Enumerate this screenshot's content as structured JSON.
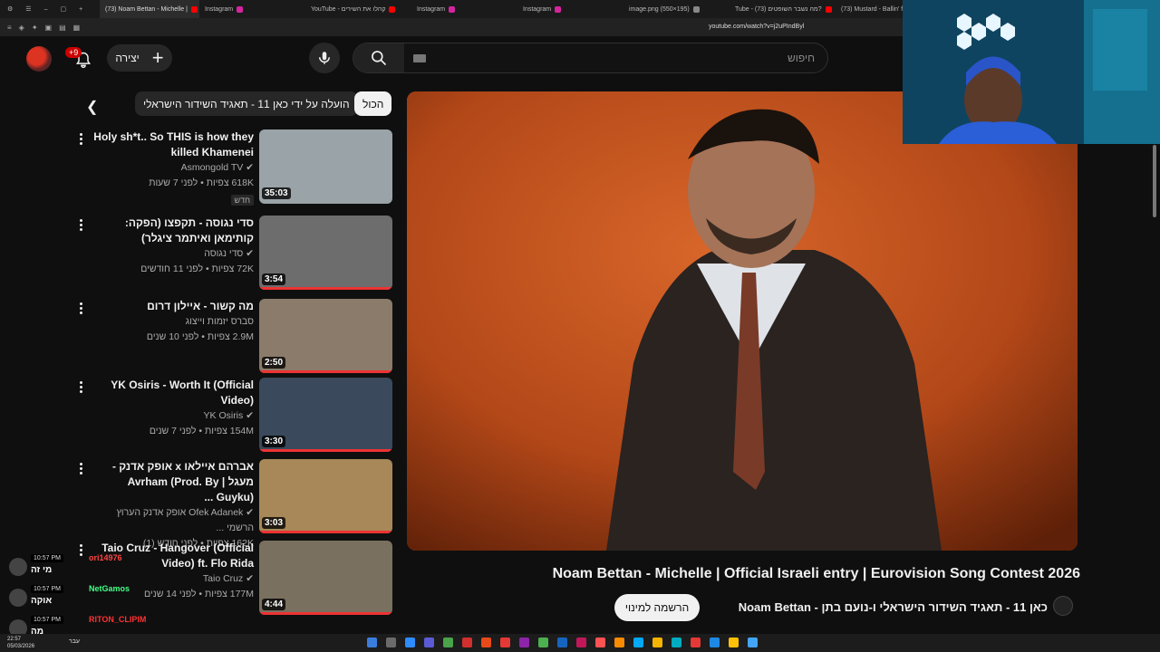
{
  "browser": {
    "tabs": [
      {
        "label": "(73) Noam Bettan - Michelle |",
        "color": "#ff0000",
        "active": true
      },
      {
        "label": "Instagram",
        "color": "#d6249f"
      },
      {
        "label": "YouTube - קהלו את השירים",
        "color": "#ff0000"
      },
      {
        "label": "Instagram",
        "color": "#d6249f"
      },
      {
        "label": "Instagram",
        "color": "#d6249f"
      },
      {
        "label": "image.png (550×195)",
        "color": "#888888"
      },
      {
        "label": "Tube - (73) מה נשבר השופטים?",
        "color": "#ff0000"
      },
      {
        "label": "(73) Mustard - Ballin' ft.",
        "color": "#ff0000"
      }
    ],
    "url": "youtube.com/watch?v=j2uPIndByl"
  },
  "header": {
    "notification_count": "+9",
    "create_label": "יצירה",
    "search_placeholder": "חיפוש"
  },
  "chips": {
    "all_label": "הכול",
    "uploaded_label": "הועלה על ידי כאן 11 - תאגיד השידור הישראלי"
  },
  "recommendations": [
    {
      "title": "Holy sh*t.. So THIS is how they killed Khamenei",
      "channel": "Asmongold TV",
      "verified": true,
      "meta": "618K צפיות • לפני 7 שעות",
      "badge": "חדש",
      "duration": "35:03",
      "thumb": "#9aa3a8",
      "has_progress": false
    },
    {
      "title": "סדי נגוסה - תקפצו (הפקה: קותימאן ואיתמר ציגלר)",
      "channel": "סדי נגוסה",
      "verified": true,
      "meta": "72K צפיות • לפני 11 חודשים",
      "badge": "",
      "duration": "3:54",
      "thumb": "#6d6d6d",
      "has_progress": true
    },
    {
      "title": "מה קשור - איילון דרום",
      "channel": "סברס יזמות וייצוג",
      "verified": false,
      "meta": "2.9M צפיות • לפני 10 שנים",
      "badge": "",
      "duration": "2:50",
      "thumb": "#8a7b6a",
      "has_progress": true
    },
    {
      "title": "YK Osiris - Worth It (Official Video)",
      "channel": "YK Osiris",
      "verified": true,
      "meta": "154M צפיות • לפני 7 שנים",
      "badge": "",
      "duration": "3:30",
      "thumb": "#3a4a5c",
      "has_progress": true
    },
    {
      "title": "אברהם איילאו x אופק אדנק - מעגל | Avrham (Prod. By Guyku) ...",
      "channel": "Ofek Adanek אופק אדנק הערוץ הרשמי ...",
      "verified": true,
      "meta": "162K צפיות • לפני חודש (1)",
      "badge": "",
      "duration": "3:03",
      "thumb": "#a88858",
      "has_progress": true
    },
    {
      "title": "Taio Cruz - Hangover (Official Video) ft. Flo Rida",
      "channel": "Taio Cruz",
      "verified": true,
      "meta": "177M צפיות • לפני 14 שנים",
      "badge": "",
      "duration": "4:44",
      "thumb": "#7a7060",
      "has_progress": true
    }
  ],
  "video": {
    "title": "Noam Bettan - Michelle | Official Israeli entry | Eurovision Song Contest 2026",
    "channel_line": "כאן 11 - תאגיד השידור הישראלי ו-נועם בתן - Noam Bettan",
    "subscribe_label": "הרשמה למינוי"
  },
  "chat": [
    {
      "time": "10:57 PM",
      "user": "ori14976",
      "message": "מי זה",
      "color": "#ff4444"
    },
    {
      "time": "10:57 PM",
      "user": "NetGamos",
      "message": "אוקה",
      "color": "#44ff88"
    },
    {
      "time": "10:57 PM",
      "user": "RITON_CLIPIM",
      "message": "מה",
      "color": "#ff3333"
    }
  ],
  "taskbar": {
    "time": "22:57",
    "date": "05/03/2026",
    "language": "עבר"
  }
}
